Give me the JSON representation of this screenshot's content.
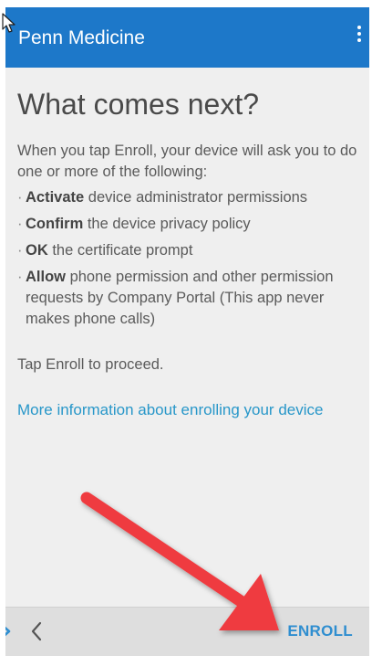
{
  "appbar": {
    "title": "Penn Medicine",
    "menu_icon": "overflow-menu-icon",
    "color": "#1d78c9"
  },
  "content": {
    "heading": "What comes next?",
    "intro": "When you tap Enroll, your device will ask you to do one or more of the following:",
    "steps": [
      {
        "bullet": "·",
        "bold": "Activate",
        "rest": " device administrator permissions"
      },
      {
        "bullet": "·",
        "bold": "Confirm",
        "rest": " the device privacy policy"
      },
      {
        "bullet": "·",
        "bold": "OK",
        "rest": " the certificate prompt"
      },
      {
        "bullet": "·",
        "bold": "Allow",
        "rest": " phone permission and other permission requests by Company Portal (This app never makes phone calls)"
      }
    ],
    "proceed": "Tap Enroll to proceed.",
    "more_link": "More information about enrolling your device",
    "link_color": "#2897c9"
  },
  "bottombar": {
    "back_icon": "chevron-left-icon",
    "enroll_label": "ENROLL",
    "enroll_color": "#2f8ed0"
  },
  "annotation": {
    "arrow_color": "#ef3b3f"
  }
}
